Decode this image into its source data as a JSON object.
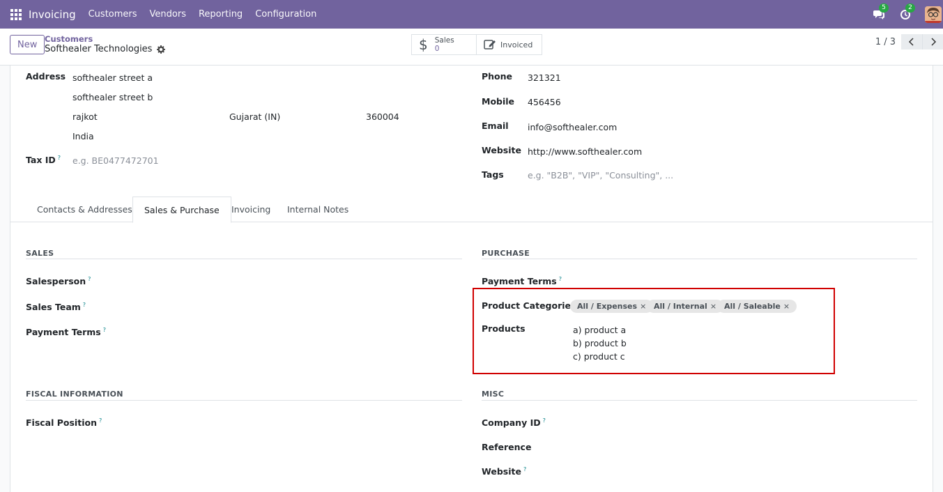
{
  "navbar": {
    "brand": "Invoicing",
    "menu": [
      "Customers",
      "Vendors",
      "Reporting",
      "Configuration"
    ],
    "messages_count": "5",
    "activities_count": "2"
  },
  "control": {
    "new_label": "New",
    "breadcrumb": "Customers",
    "record_title": "Softhealer Technologies",
    "smart_sales_label": "Sales",
    "smart_sales_value": "0",
    "smart_invoiced_label": "Invoiced",
    "pager": "1 / 3"
  },
  "address": {
    "label": "Address",
    "street": "softhealer street a",
    "street2": "softhealer street b",
    "city": "rajkot",
    "state": "Gujarat (IN)",
    "zip": "360004",
    "country": "India"
  },
  "tax": {
    "label": "Tax ID",
    "help": "?",
    "placeholder": "e.g. BE0477472701"
  },
  "contact": {
    "phone_label": "Phone",
    "phone": "321321",
    "mobile_label": "Mobile",
    "mobile": "456456",
    "email_label": "Email",
    "email": "info@softhealer.com",
    "website_label": "Website",
    "website": "http://www.softhealer.com",
    "tags_label": "Tags",
    "tags_placeholder": "e.g. \"B2B\", \"VIP\", \"Consulting\", ..."
  },
  "tabs": [
    "Contacts & Addresses",
    "Sales & Purchase",
    "Invoicing",
    "Internal Notes"
  ],
  "sales": {
    "title": "SALES",
    "salesperson": "Salesperson",
    "sales_team": "Sales Team",
    "payment_terms": "Payment Terms"
  },
  "purchase": {
    "title": "PURCHASE",
    "payment_terms": "Payment Terms",
    "product_categories": "Product Categories",
    "categories": [
      "All / Expenses",
      "All / Internal",
      "All / Saleable"
    ],
    "products_label": "Products",
    "products": [
      "a) product a",
      "b) product b",
      "c) product c"
    ]
  },
  "fiscal": {
    "title": "FISCAL INFORMATION",
    "fiscal_position": "Fiscal Position"
  },
  "misc": {
    "title": "MISC",
    "company_id": "Company ID",
    "reference": "Reference",
    "website": "Website"
  },
  "help_mark": "?",
  "remove_mark": "×"
}
